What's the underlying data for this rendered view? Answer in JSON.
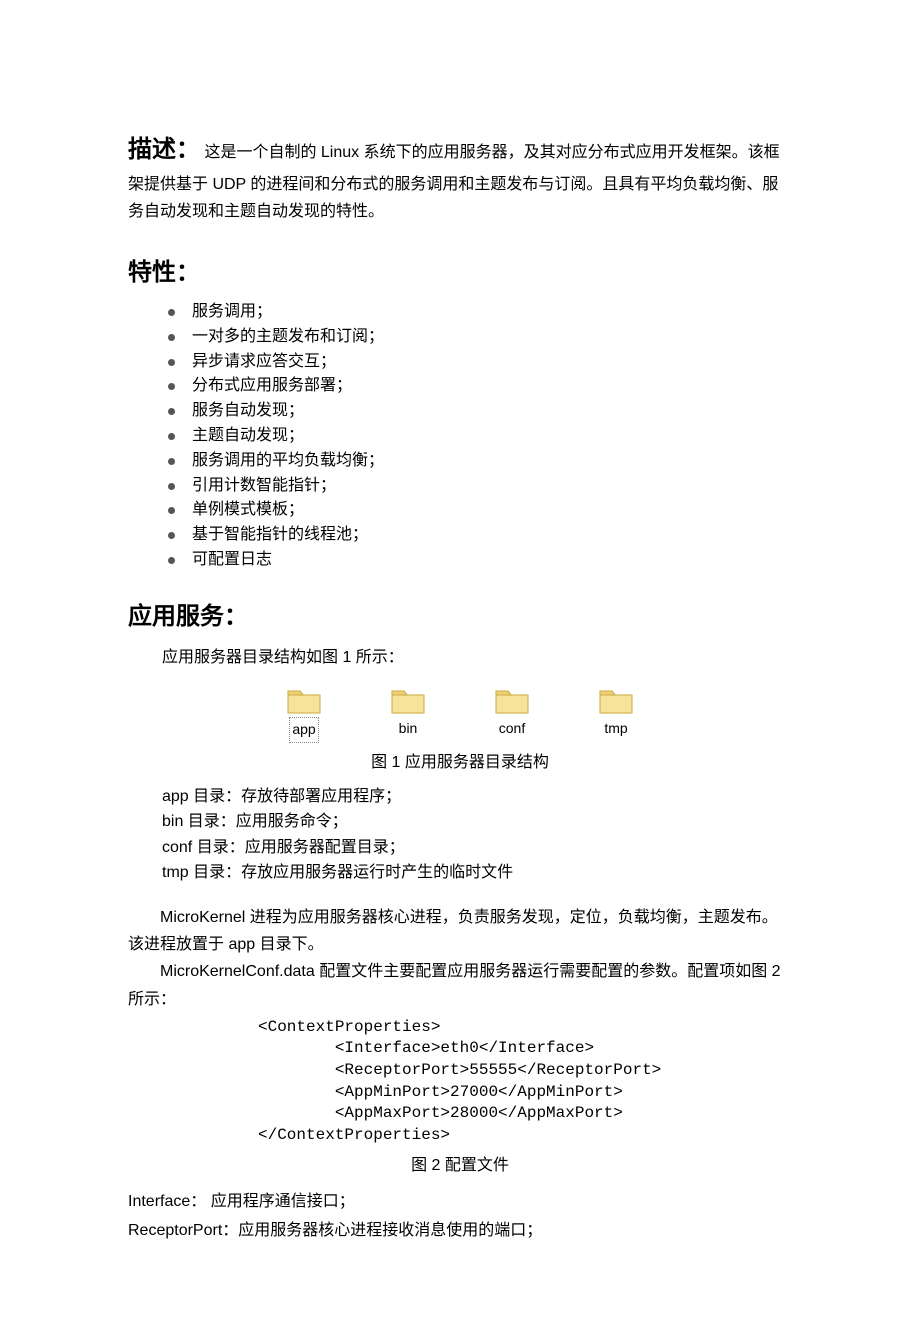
{
  "description": {
    "label": "描述：",
    "text": "这是一个自制的 Linux 系统下的应用服务器，及其对应分布式应用开发框架。该框架提供基于 UDP 的进程间和分布式的服务调用和主题发布与订阅。且具有平均负载均衡、服务自动发现和主题自动发现的特性。"
  },
  "features": {
    "heading": "特性：",
    "items": [
      "服务调用；",
      "一对多的主题发布和订阅；",
      "异步请求应答交互；",
      "分布式应用服务部署；",
      " 服务自动发现；",
      "主题自动发现；",
      "服务调用的平均负载均衡；",
      "引用计数智能指针；",
      "单例模式模板；",
      "基于智能指针的线程池；",
      "可配置日志"
    ]
  },
  "appservice": {
    "heading": "应用服务：",
    "intro": "应用服务器目录结构如图 1 所示：",
    "folders": [
      {
        "label": "app",
        "selected": true
      },
      {
        "label": "bin",
        "selected": false
      },
      {
        "label": "conf",
        "selected": false
      },
      {
        "label": "tmp",
        "selected": false
      }
    ],
    "caption1": "图 1 应用服务器目录结构",
    "dir_desc": [
      "app 目录：存放待部署应用程序；",
      "bin 目录：应用服务命令；",
      "conf 目录：应用服务器配置目录；",
      "tmp 目录：存放应用服务器运行时产生的临时文件"
    ],
    "para1": "MicroKernel 进程为应用服务器核心进程，负责服务发现，定位，负载均衡，主题发布。该进程放置于 app 目录下。",
    "para2": "MicroKernelConf.data 配置文件主要配置应用服务器运行需要配置的参数。配置项如图 2 所示：",
    "xml": "<ContextProperties>\n        <Interface>eth0</Interface>\n        <ReceptorPort>55555</ReceptorPort>\n        <AppMinPort>27000</AppMinPort>\n        <AppMaxPort>28000</AppMaxPort>\n</ContextProperties>",
    "caption2": "图 2 配置文件",
    "defs": [
      "Interface：  应用程序通信接口；",
      "ReceptorPort：应用服务器核心进程接收消息使用的端口；"
    ]
  }
}
